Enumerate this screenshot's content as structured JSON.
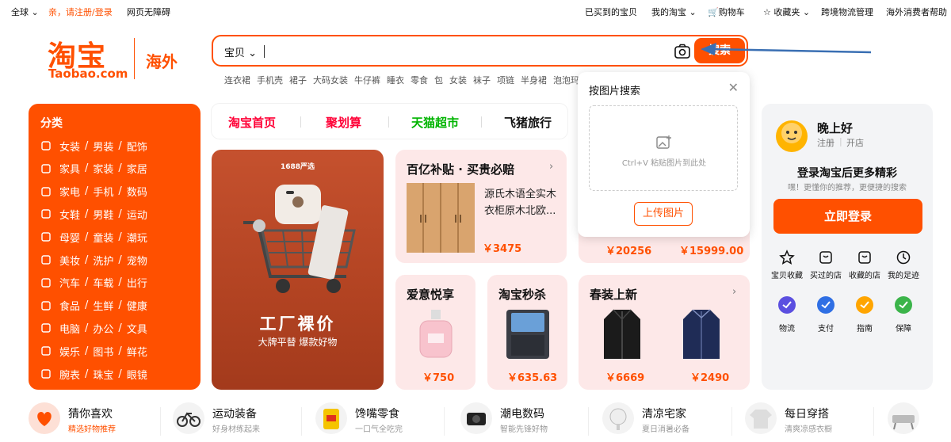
{
  "topbar": {
    "region": "全球",
    "login_prompt": "亲，请注册/登录",
    "accessibility": "网页无障碍",
    "bought": "已买到的宝贝",
    "my_taobao": "我的淘宝",
    "cart": "购物车",
    "favorites": "收藏夹",
    "logistics": "跨境物流管理",
    "consumer": "海外消费者帮助"
  },
  "logo": {
    "cn": "淘宝",
    "en": "Taobao.com",
    "region": "海外"
  },
  "search": {
    "category": "宝贝",
    "button": "搜索"
  },
  "hot_keywords": [
    "连衣裙",
    "手机壳",
    "裙子",
    "大码女装",
    "牛仔裤",
    "睡衣",
    "零食",
    "包",
    "女装",
    "袜子",
    "项链",
    "半身裙",
    "泡泡玛特"
  ],
  "categories": {
    "title": "分类",
    "rows": [
      [
        "女装",
        "男装",
        "配饰"
      ],
      [
        "家具",
        "家装",
        "家居"
      ],
      [
        "家电",
        "手机",
        "数码"
      ],
      [
        "女鞋",
        "男鞋",
        "运动"
      ],
      [
        "母婴",
        "童装",
        "潮玩"
      ],
      [
        "美妆",
        "洗护",
        "宠物"
      ],
      [
        "汽车",
        "车载",
        "出行"
      ],
      [
        "食品",
        "生鲜",
        "健康"
      ],
      [
        "电脑",
        "办公",
        "文具"
      ],
      [
        "娱乐",
        "图书",
        "鲜花"
      ],
      [
        "腕表",
        "珠宝",
        "眼镜"
      ]
    ]
  },
  "tabs": [
    "淘宝首页",
    "聚划算",
    "天猫超市",
    "飞猪旅行"
  ],
  "factory": {
    "badge": "1688严选",
    "title": "工厂裸价",
    "subtitle": "大牌平替 爆款好物"
  },
  "subsidy": {
    "title": "百亿补贴 · 买贵必赔",
    "product": "源氏木语全实木衣柜原木北欧...",
    "price": "￥3475"
  },
  "hidden_prices": [
    "￥20256",
    "￥15999.00"
  ],
  "love": {
    "title": "爱意悦享",
    "price": "￥750"
  },
  "seckill": {
    "title": "淘宝秒杀",
    "price": "￥635.63"
  },
  "spring": {
    "title": "春装上新",
    "prices": [
      "￥6669",
      "￥2490"
    ]
  },
  "popup": {
    "title": "按图片搜索",
    "hint": "Ctrl+V 粘贴图片到此处",
    "upload": "上传图片"
  },
  "user": {
    "greeting": "晚上好",
    "register": "注册",
    "open_store": "开店",
    "promo": "登录淘宝后更多精彩",
    "promo_sub": "嘿！更懂你的推荐，更便捷的搜索",
    "login_button": "立即登录",
    "quick": [
      "宝贝收藏",
      "买过的店",
      "收藏的店",
      "我的足迹"
    ],
    "services": [
      "物流",
      "支付",
      "指南",
      "保障"
    ]
  },
  "bottom": [
    {
      "title": "猜你喜欢",
      "sub": "精选好物推荐"
    },
    {
      "title": "运动装备",
      "sub": "好身材练起来"
    },
    {
      "title": "馋嘴零食",
      "sub": "一口气全吃完"
    },
    {
      "title": "潮电数码",
      "sub": "智能先锋好物"
    },
    {
      "title": "清凉宅家",
      "sub": "夏日消暑必备"
    },
    {
      "title": "每日穿搭",
      "sub": "清爽凉感衣橱"
    }
  ],
  "colors": {
    "brand": "#ff5000",
    "card_pink": "#fde8e8",
    "tab_red": "#ff0036",
    "tab_green": "#00b400"
  }
}
